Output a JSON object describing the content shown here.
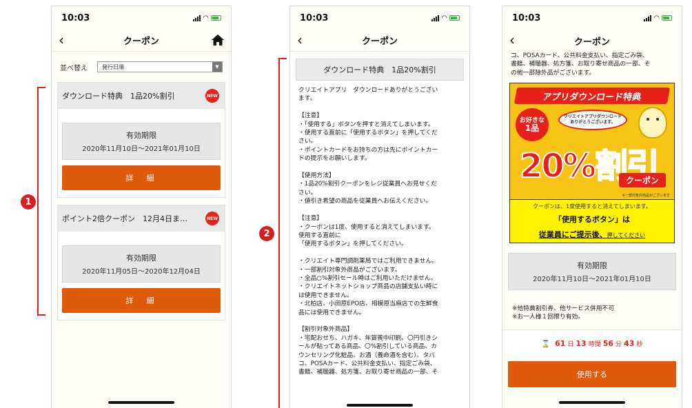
{
  "status_time": "10:03",
  "nav_title": "クーポン",
  "screen1": {
    "sort_label": "並べ替え",
    "sort_value": "発行日順",
    "coupons": [
      {
        "title": "ダウンロード特典　1品20%割引",
        "badge": "NEW",
        "validity_label": "有効期限",
        "validity_range": "2020年11月10日〜2021年01月10日",
        "button": "詳　細"
      },
      {
        "title": "ポイント2倍クーポン　12月4日ま…",
        "badge": "NEW",
        "validity_label": "有効期限",
        "validity_range": "2020年11月05日〜2020年12月04日",
        "button": "詳　細"
      }
    ]
  },
  "markers": {
    "one": "1",
    "two": "2"
  },
  "screen2": {
    "title": "ダウンロード特典　1品20%割引",
    "body": "クリエイトアプリ　ダウンロードありがとうござい\nます。\n\n【注意】\n・「使用する」ボタンを押すと消えてしまいます。\n・使用する直前に「使用するボタン」を押してくだ\nさい。\n・ポイントカードをお持ちの方は先にポイントカー\nドの提示をお願いします。\n\n【使用方法】\n・1品20%割引クーポンをレジ従業員へお見せくだ\nさい。\n・値引き希望の商品を従業員へお伝えください。\n\n【注意】\n・クーポンは1度、使用すると消えてしまいます。\n使用する直前に\n「使用するボタン」を押してください。\n\n・クリエイト専門調剤薬局ではご利用できません。\n・一部割引対象外商品がございます。\n・全品○%割引セール時はご利用いただけません。\n・クリエイトネットショップ商品の店舗支払い時に\nは使用できません。\n・北柏店、小田原EPO店、相模原当麻店での生鮮食\n品には使用できません。\n\n【割引対象外商品】\n・宅配おせち、ハガキ、年賀喪中印刷、〇円引きシ\nールが貼ってある商品、〇%割引している商品、カ\nウンセリング化粧品、お酒（養命酒を含む）、タバ\nコ、POSAカード、公共料金支払い、指定ごみ袋、\n書籍、補聴器、処方箋、お取り寄せ商品の一部、そ"
  },
  "screen3": {
    "top_text": "コ、POSAカード、公共料金支払い、指定ごみ袋、\n書籍、補聴器、処方箋、お取り寄せ商品の一部、そ\nの他一部除外品がございます。",
    "banner": {
      "headline": "アプリダウンロード特典",
      "circle_line1": "お好きな",
      "circle_line2": "1品",
      "bubble_line1": "クリエイトアプリダウンロード",
      "bubble_line2": "ありがとうございます。",
      "big": "20%割引",
      "coupon": "クーポン",
      "fine_print": "※一部対象外商品がございます",
      "line1": "クーポンは、1度使用すると消えてしまいます。",
      "line2": "「使用するボタン」は",
      "line3_main": "従業員にご提示後、",
      "line3_sub": "押してください"
    },
    "validity_label": "有効期限",
    "validity_range": "2020年11月10日〜2021年01月10日",
    "notes": "※他特典割引券、他サービス併用不可\n※お一人様１回限り有効。",
    "countdown": {
      "days": "61",
      "days_unit": "日",
      "hours": "13",
      "hours_unit": "時間",
      "minutes": "56",
      "minutes_unit": "分",
      "seconds": "43",
      "seconds_unit": "秒"
    },
    "use_button": "使用する"
  }
}
